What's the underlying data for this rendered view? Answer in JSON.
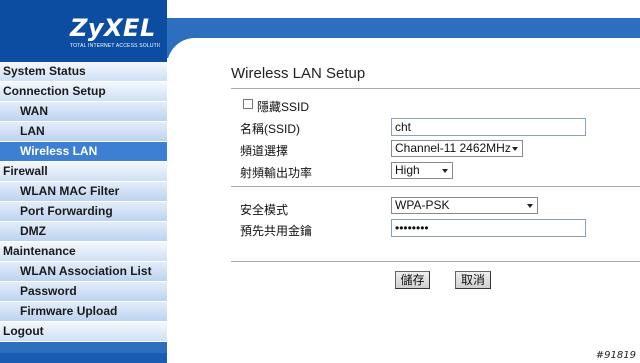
{
  "brand": {
    "logo": "ZyXEL",
    "tagline": "TOTAL INTERNET ACCESS SOLUTION"
  },
  "menu": [
    {
      "label": "System Status",
      "type": "cat",
      "name": "menu-system-status"
    },
    {
      "label": "Connection Setup",
      "type": "cat",
      "name": "menu-connection-setup"
    },
    {
      "label": "WAN",
      "type": "sub",
      "name": "menu-wan"
    },
    {
      "label": "LAN",
      "type": "sub",
      "name": "menu-lan"
    },
    {
      "label": "Wireless LAN",
      "type": "sub",
      "active": true,
      "name": "menu-wireless-lan"
    },
    {
      "label": "Firewall",
      "type": "cat",
      "name": "menu-firewall"
    },
    {
      "label": "WLAN MAC Filter",
      "type": "sub",
      "name": "menu-wlan-mac-filter"
    },
    {
      "label": "Port Forwarding",
      "type": "sub",
      "name": "menu-port-forwarding"
    },
    {
      "label": "DMZ",
      "type": "sub",
      "name": "menu-dmz"
    },
    {
      "label": "Maintenance",
      "type": "cat",
      "name": "menu-maintenance"
    },
    {
      "label": "WLAN Association List",
      "type": "sub",
      "name": "menu-wlan-association-list"
    },
    {
      "label": "Password",
      "type": "sub",
      "name": "menu-password"
    },
    {
      "label": "Firmware Upload",
      "type": "sub",
      "name": "menu-firmware-upload"
    },
    {
      "label": "Logout",
      "type": "cat",
      "name": "menu-logout"
    }
  ],
  "page": {
    "title": "Wireless LAN Setup"
  },
  "form": {
    "hide_ssid_label": "隱藏SSID",
    "hide_ssid_checked": false,
    "ssid_label": "名稱(SSID)",
    "ssid_value": "cht",
    "channel_label": "頻道選擇",
    "channel_value": "Channel-11 2462MHz",
    "power_label": "射頻輸出功率",
    "power_value": "High",
    "security_label": "安全模式",
    "security_value": "WPA-PSK",
    "psk_label": "預先共用金鑰",
    "psk_value": "••••••••"
  },
  "buttons": {
    "save": "儲存",
    "cancel": "取消"
  },
  "watermark": "#91819"
}
